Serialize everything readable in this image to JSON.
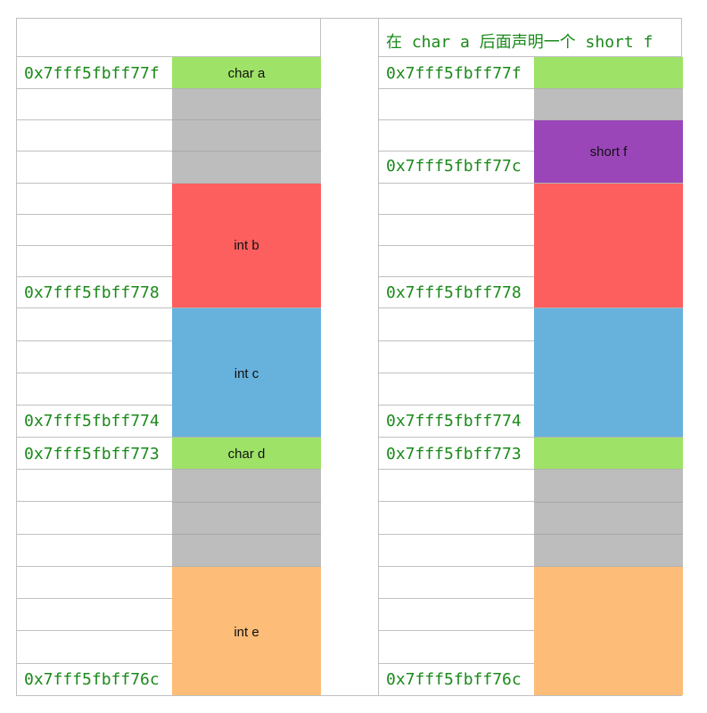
{
  "left": {
    "header": "",
    "addresses": {
      "a": "0x7fff5fbff77f",
      "b": "0x7fff5fbff778",
      "c": "0x7fff5fbff774",
      "d": "0x7fff5fbff773",
      "e": "0x7fff5fbff76c"
    },
    "blocks": {
      "char_a": "char a",
      "int_b": "int b",
      "int_c": "int c",
      "char_d": "char d",
      "int_e": "int e"
    }
  },
  "right": {
    "header": "在 char a 后面声明一个 short f",
    "addresses": {
      "a": "0x7fff5fbff77f",
      "f": "0x7fff5fbff77c",
      "b": "0x7fff5fbff778",
      "c": "0x7fff5fbff774",
      "d": "0x7fff5fbff773",
      "e": "0x7fff5fbff76c"
    },
    "blocks": {
      "short_f": "short f"
    }
  },
  "colors": {
    "char": "#9ee267",
    "padding": "#bdbdbd",
    "int_b": "#fd5f5f",
    "int_c": "#67b1dd",
    "int_e": "#fdbc78",
    "short": "#9a46b8",
    "address_text": "#1a8a1a"
  }
}
